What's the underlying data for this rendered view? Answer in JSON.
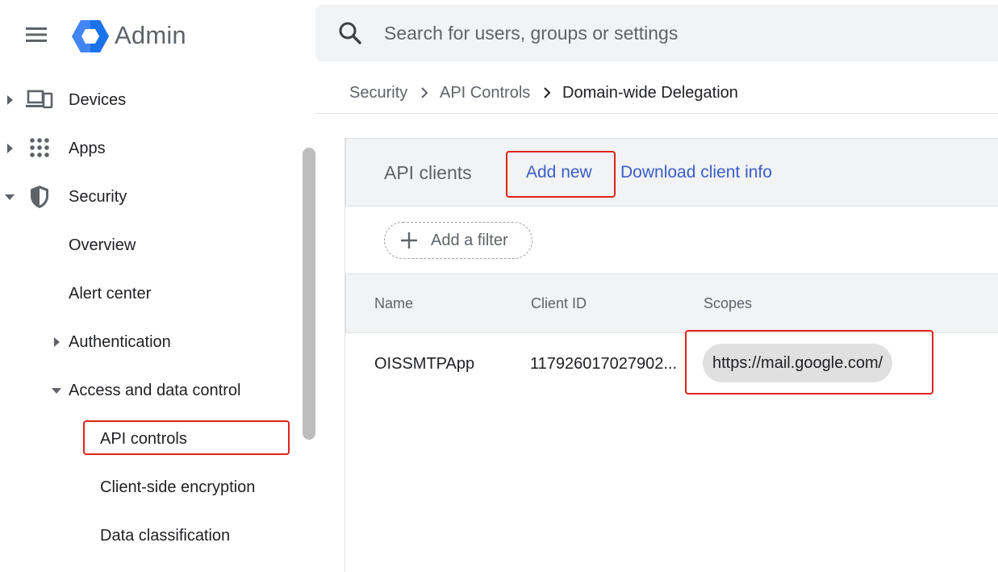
{
  "header": {
    "app_title": "Admin",
    "search_placeholder": "Search for users, groups or settings"
  },
  "sidebar": {
    "items": [
      {
        "label": "Devices",
        "icon": "devices-icon",
        "expanded": false
      },
      {
        "label": "Apps",
        "icon": "apps-grid-icon",
        "expanded": false
      },
      {
        "label": "Security",
        "icon": "shield-icon",
        "expanded": true
      }
    ],
    "security_children": {
      "overview": "Overview",
      "alert_center": "Alert center",
      "authentication": "Authentication",
      "access_and_data_control": "Access and data control",
      "api_controls": "API controls",
      "client_side_encryption": "Client-side encryption",
      "data_classification": "Data classification"
    }
  },
  "breadcrumb": {
    "items": [
      "Security",
      "API Controls",
      "Domain-wide Delegation"
    ]
  },
  "card": {
    "title": "API clients",
    "add_new": "Add new",
    "download": "Download client info",
    "filter_label": "Add a filter"
  },
  "table": {
    "headers": [
      "Name",
      "Client ID",
      "Scopes"
    ],
    "rows": [
      {
        "name": "OISSMTPApp",
        "client_id": "117926017027902...",
        "scope": "https://mail.google.com/"
      }
    ]
  },
  "colors": {
    "accent_link": "#3b5dc9",
    "highlight_red": "#e0221b",
    "logo_blue": "#4285f4"
  }
}
